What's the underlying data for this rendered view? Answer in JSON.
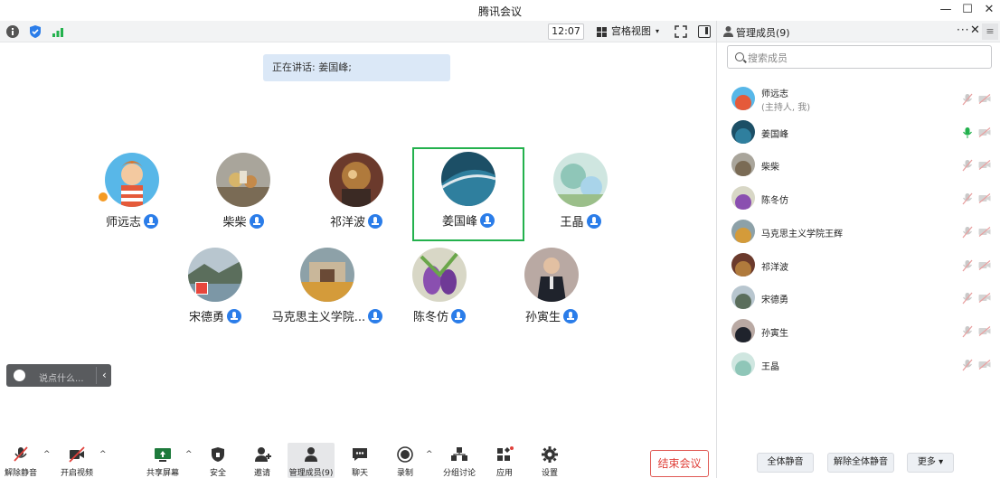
{
  "window": {
    "title": "腾讯会议",
    "controls": {
      "minimize": "—",
      "maximize": "☐",
      "close": "✕"
    }
  },
  "toolbar": {
    "time": "12:07",
    "view_label": "宫格视图",
    "view_caret": "▾",
    "signal_color": "#23b14d",
    "shield_color": "#2b7de9"
  },
  "speaking": {
    "text": "正在讲话: 姜国峰;"
  },
  "participants": [
    {
      "name": "师远志"
    },
    {
      "name": "柴柴"
    },
    {
      "name": "祁洋波"
    },
    {
      "name": "姜国峰",
      "speaking": true
    },
    {
      "name": "王晶"
    },
    {
      "name": "宋德勇"
    },
    {
      "name": "马克思主义学院..."
    },
    {
      "name": "陈冬仿"
    },
    {
      "name": "孙寅生"
    }
  ],
  "chat": {
    "placeholder": "说点什么...",
    "collapse": "‹"
  },
  "bottom_toolbar": {
    "mute": "解除静音",
    "video": "开启视频",
    "share": "共享屏幕",
    "security": "安全",
    "invite": "邀请",
    "members": "管理成员(9)",
    "chat": "聊天",
    "record": "录制",
    "breakout": "分组讨论",
    "apps": "应用",
    "settings": "设置",
    "end": "结束会议",
    "caret": "^"
  },
  "panel": {
    "title": "管理成员(9)",
    "more": "···",
    "close": "✕",
    "menu": "≡",
    "search_placeholder": "搜索成员",
    "members": [
      {
        "name": "师远志",
        "role": "(主持人, 我)"
      },
      {
        "name": "姜国峰",
        "mic_on": true
      },
      {
        "name": "柴柴"
      },
      {
        "name": "陈冬仿"
      },
      {
        "name": "马克思主义学院王辉"
      },
      {
        "name": "祁洋波"
      },
      {
        "name": "宋德勇"
      },
      {
        "name": "孙寅生"
      },
      {
        "name": "王晶"
      }
    ],
    "mute_all": "全体静音",
    "unmute_all": "解除全体静音",
    "more_btn": "更多 ▾"
  },
  "colors": {
    "accent_blue": "#2b7de9",
    "speaking_green": "#23b14d",
    "end_red": "#e0403a",
    "muted_red": "#e8a0a0"
  }
}
